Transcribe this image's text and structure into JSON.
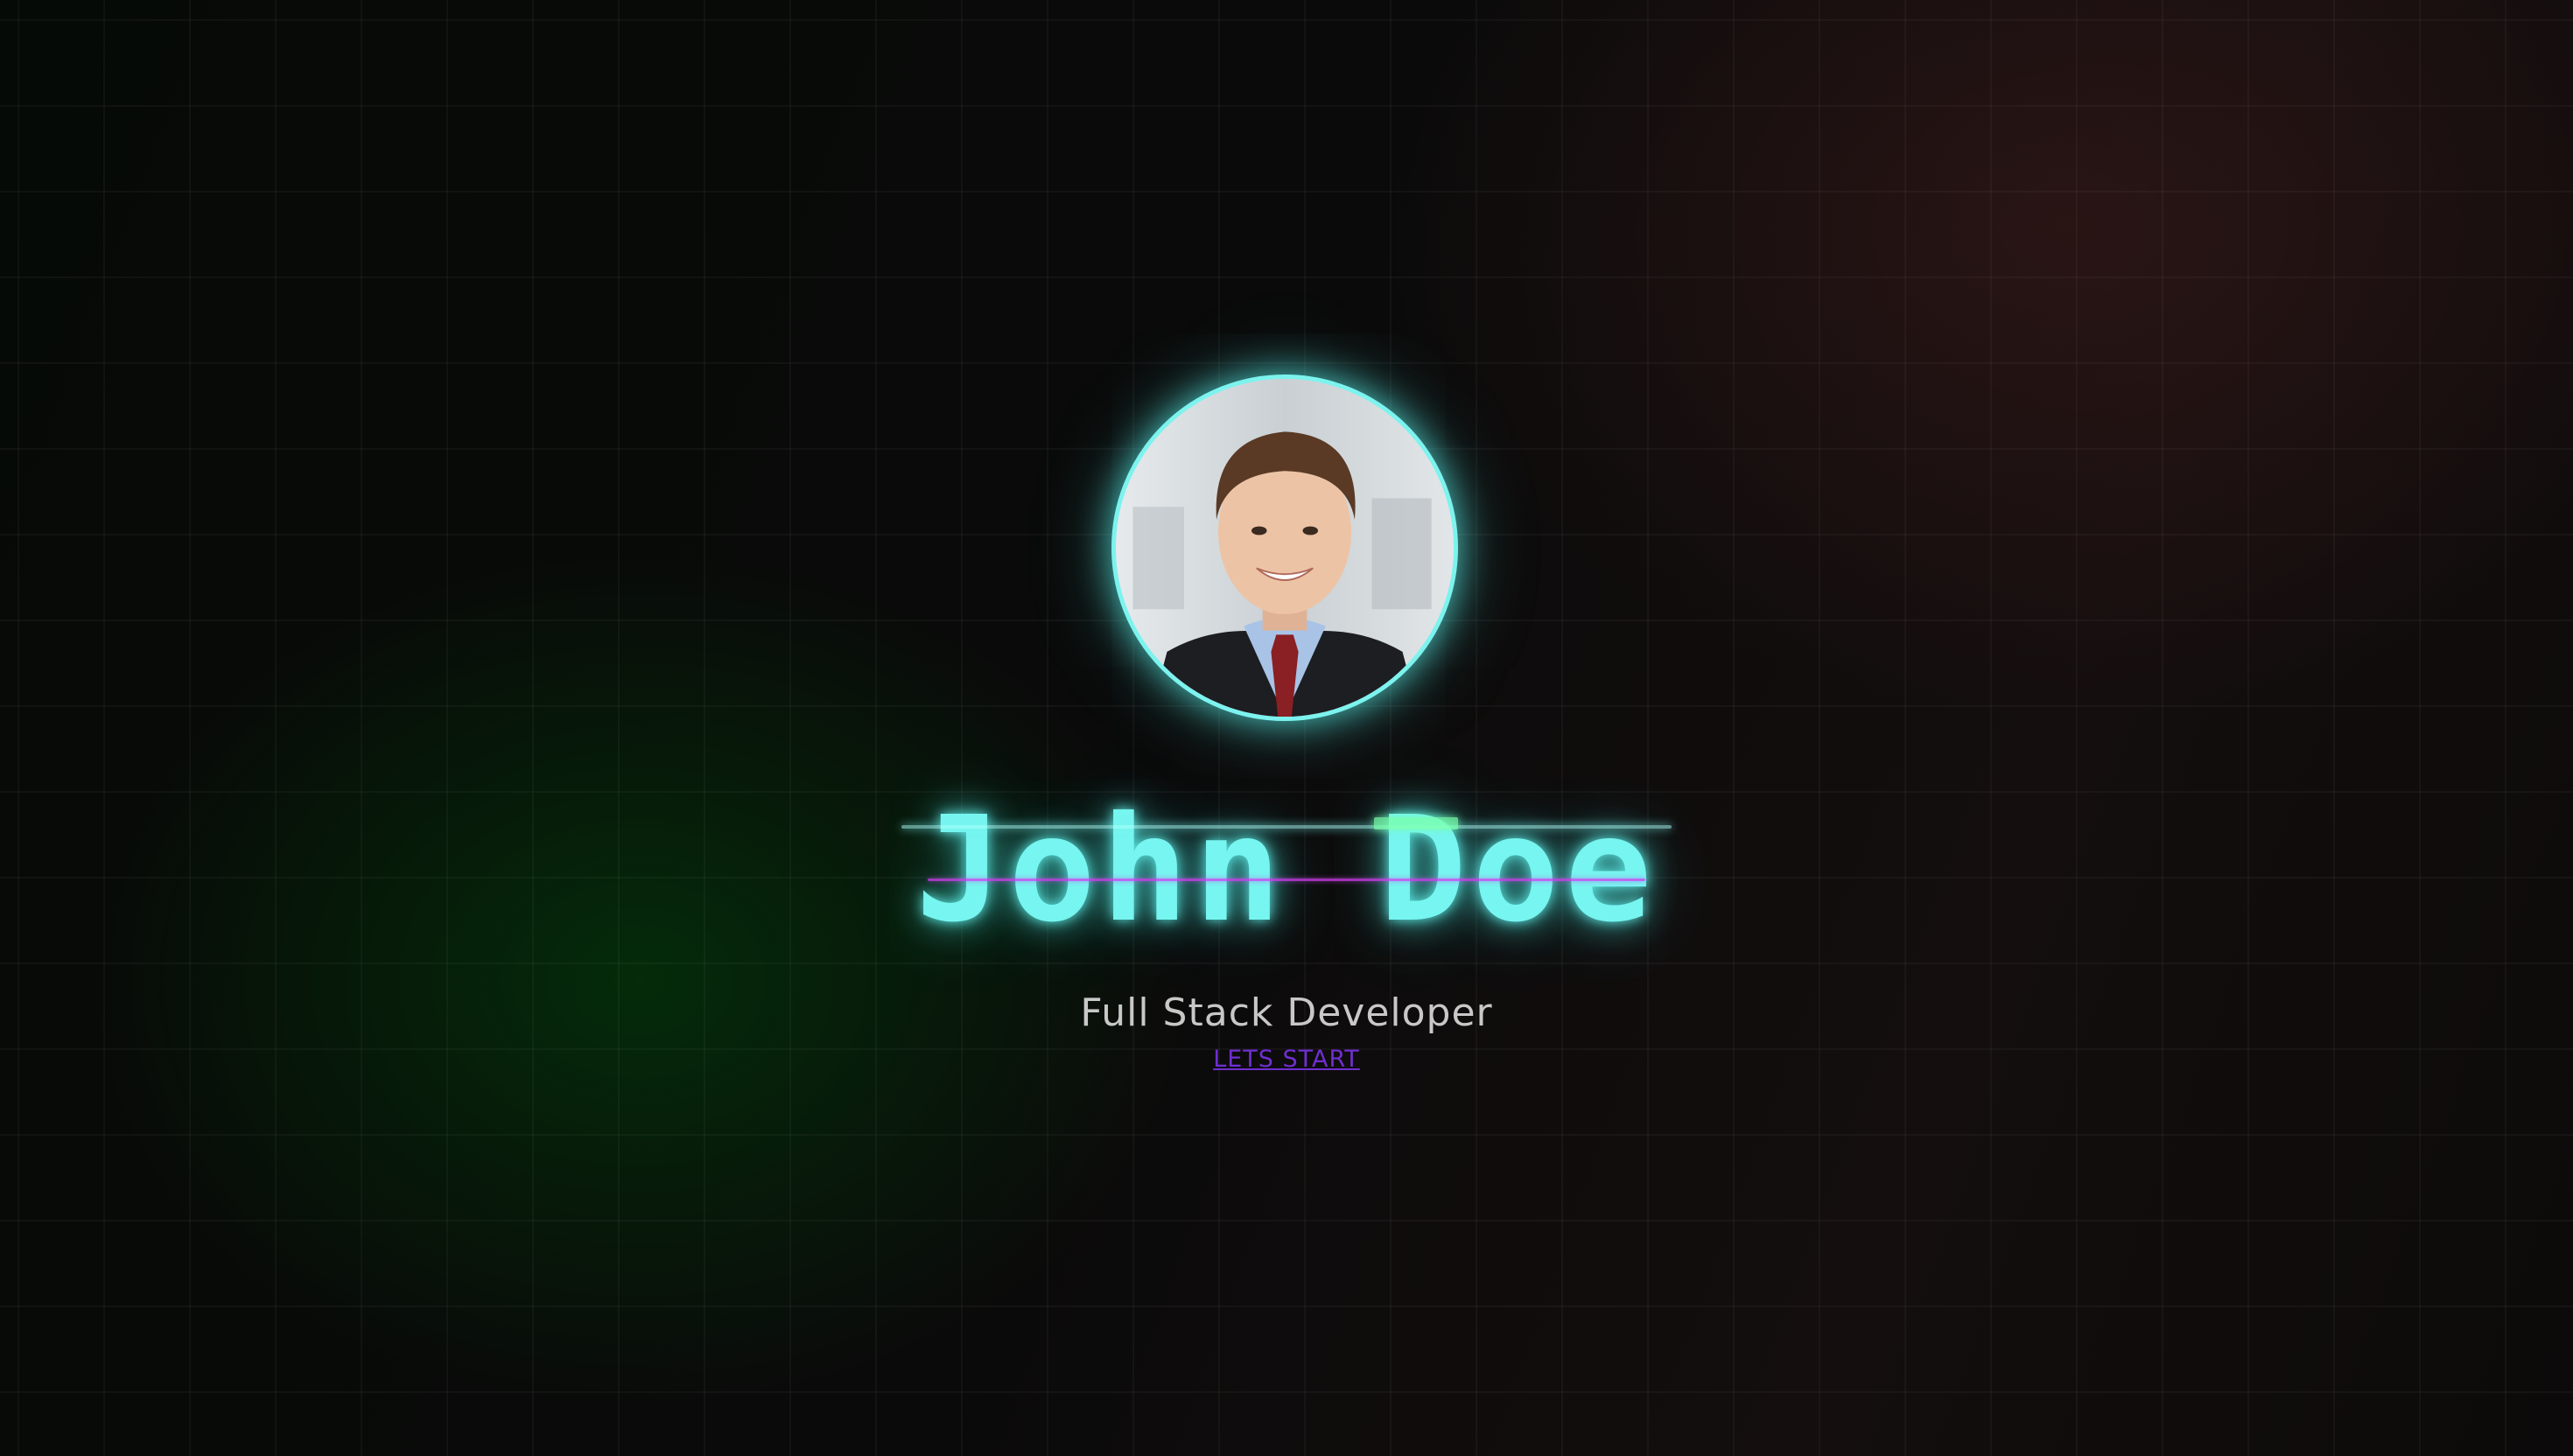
{
  "hero": {
    "name": "John Doe",
    "title": "Full Stack Developer",
    "cta_label": "LETS START"
  },
  "avatar": {
    "description": "profile photo",
    "ring_color": "#7cf3ee"
  },
  "colors": {
    "name_glow": "#77f5f0",
    "glitch_magenta": "#d23cf0",
    "glitch_green": "#78ffaa",
    "cta_link": "#6f2fd0",
    "subtitle": "#c8c8c8",
    "background": "#0a0a0a"
  }
}
